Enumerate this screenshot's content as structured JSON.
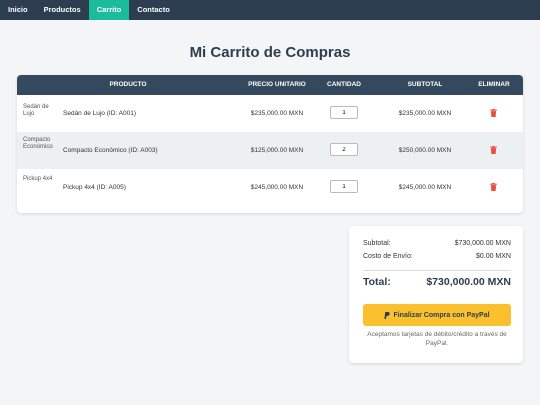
{
  "nav": {
    "items": [
      {
        "label": "Inicio",
        "active": false
      },
      {
        "label": "Productos",
        "active": false
      },
      {
        "label": "Carrito",
        "active": true
      },
      {
        "label": "Contacto",
        "active": false
      }
    ],
    "bg_color": "#2c3e50",
    "active_color": "#1abc9c"
  },
  "page": {
    "title": "Mi Carrito de Compras"
  },
  "cart": {
    "headers": {
      "product": "PRODUCTO",
      "unit_price": "PRECIO UNITARIO",
      "quantity": "CANTIDAD",
      "subtotal": "SUBTOTAL",
      "remove": "ELIMINAR"
    },
    "rows": [
      {
        "img_alt": "Sedán de Lujo",
        "name": "Sedán de Lujo (ID: A001)",
        "price": "$235,000.00 MXN",
        "qty": "1",
        "subtotal": "$235,000.00 MXN",
        "remove_icon": "trash-icon"
      },
      {
        "img_alt": "Compacto Económico",
        "name": "Compacto Económico (ID: A003)",
        "price": "$125,000.00 MXN",
        "qty": "2",
        "subtotal": "$250,000.00 MXN",
        "remove_icon": "trash-icon"
      },
      {
        "img_alt": "Pickup 4x4",
        "name": "Pickup 4x4 (ID: A005)",
        "price": "$245,000.00 MXN",
        "qty": "1",
        "subtotal": "$245,000.00 MXN",
        "remove_icon": "trash-icon"
      }
    ],
    "delete_color": "#e74c3c"
  },
  "summary": {
    "subtotal_label": "Subtotal:",
    "subtotal_value": "$730,000.00 MXN",
    "shipping_label": "Costo de Envío:",
    "shipping_value": "$0.00 MXN",
    "total_label": "Total:",
    "total_value": "$730,000.00 MXN",
    "paypal_button": "Finalizar Compra con PayPal",
    "paypal_icon": "paypal-icon",
    "note": "Aceptamos tarjetas de débito/crédito a través de PayPal.",
    "button_color": "#fbc02d"
  }
}
